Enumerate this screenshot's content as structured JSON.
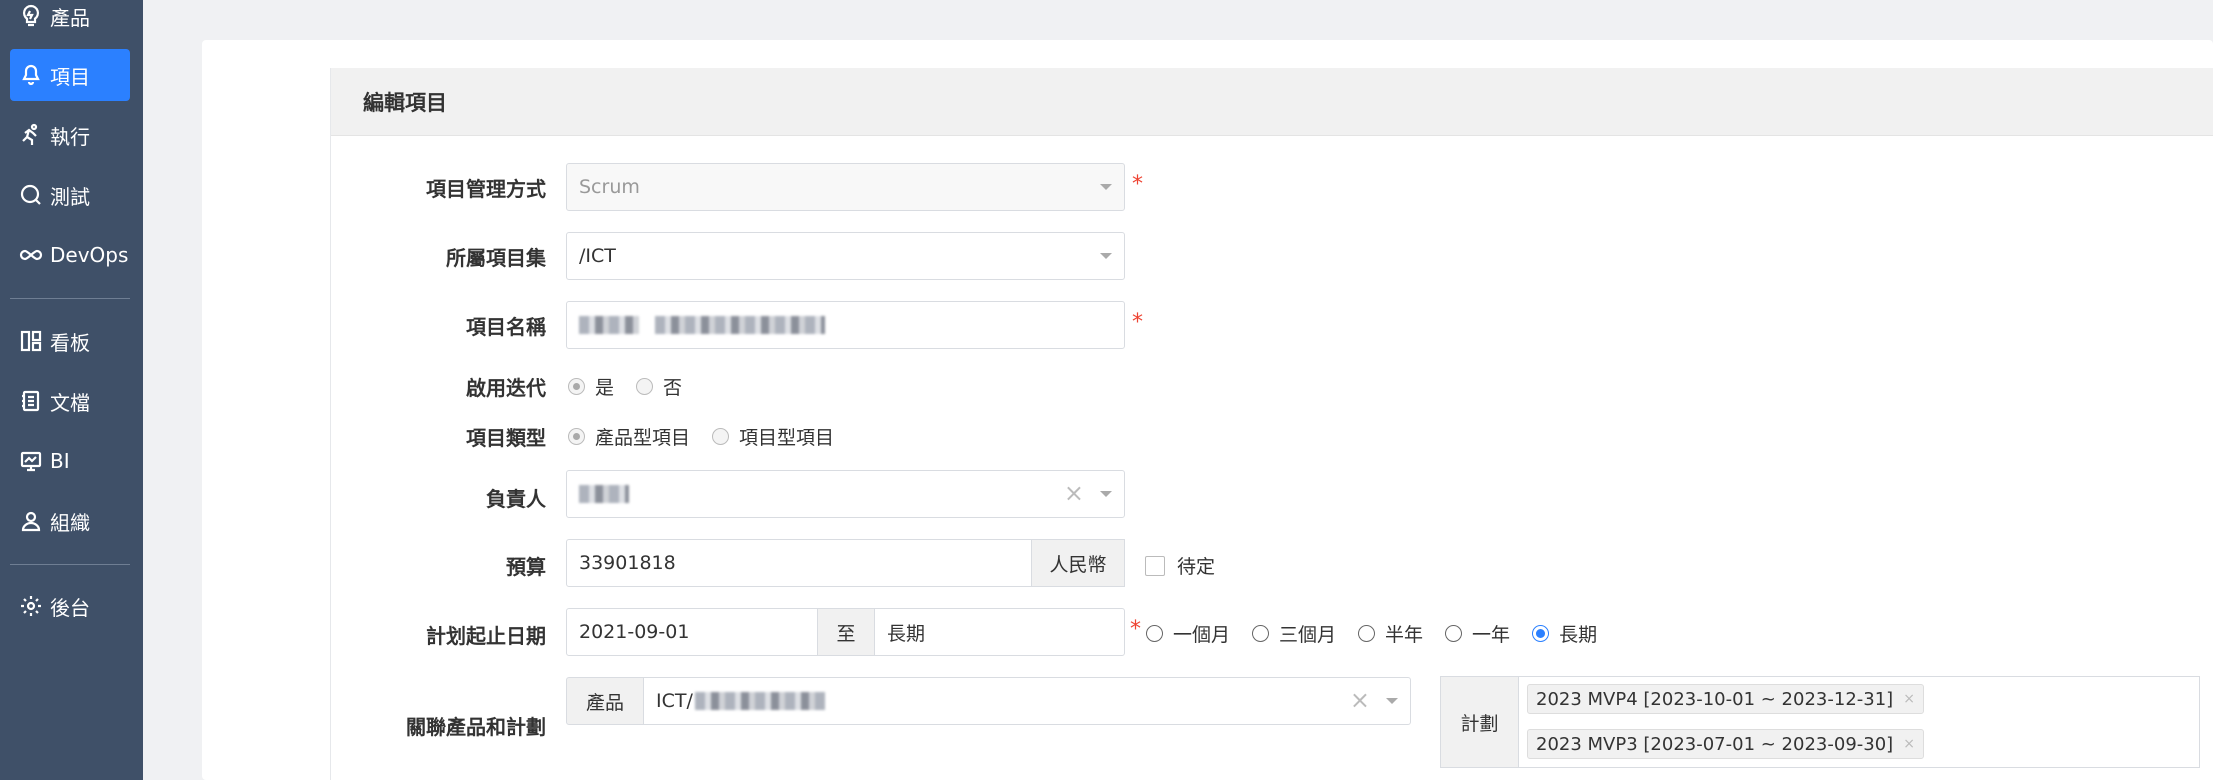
{
  "sidebar": {
    "items": [
      {
        "label": "產品",
        "icon": "lightbulb-icon"
      },
      {
        "label": "項目",
        "icon": "bell-icon",
        "active": true
      },
      {
        "label": "執行",
        "icon": "running-icon"
      },
      {
        "label": "測試",
        "icon": "search-circle-icon"
      },
      {
        "label": "DevOps",
        "icon": "infinity-icon"
      },
      {
        "label": "看板",
        "icon": "kanban-icon"
      },
      {
        "label": "文檔",
        "icon": "document-icon"
      },
      {
        "label": "BI",
        "icon": "monitor-icon"
      },
      {
        "label": "組織",
        "icon": "user-icon"
      },
      {
        "label": "後台",
        "icon": "gear-icon"
      }
    ]
  },
  "form": {
    "title": "編輯項目",
    "management": {
      "label": "項目管理方式",
      "value": "Scrum"
    },
    "program": {
      "label": "所屬項目集",
      "value": "/ICT"
    },
    "name": {
      "label": "項目名稱"
    },
    "iteration": {
      "label": "啟用迭代",
      "options": [
        "是",
        "否"
      ],
      "selected": "是"
    },
    "type": {
      "label": "項目類型",
      "options": [
        "產品型項目",
        "項目型項目"
      ],
      "selected": "產品型項目"
    },
    "owner": {
      "label": "負責人"
    },
    "budget": {
      "label": "預算",
      "value": "33901818",
      "unit": "人民幣",
      "pending_label": "待定"
    },
    "dates": {
      "label": "計划起止日期",
      "begin": "2021-09-01",
      "sep": "至",
      "end": "長期",
      "options": [
        "一個月",
        "三個月",
        "半年",
        "一年",
        "長期"
      ],
      "selected": "長期"
    },
    "linked": {
      "label": "關聯產品和計劃",
      "product_addon": "產品",
      "product_value": "ICT/",
      "plan_addon": "計劃",
      "plans": [
        "2023 MVP4 [2023-10-01 ~ 2023-12-31]",
        "2023 MVP3 [2023-07-01 ~ 2023-09-30]"
      ]
    }
  },
  "colors": {
    "sidebar": "#3f5068",
    "accent": "#2b80ff",
    "required": "#ee4433"
  }
}
